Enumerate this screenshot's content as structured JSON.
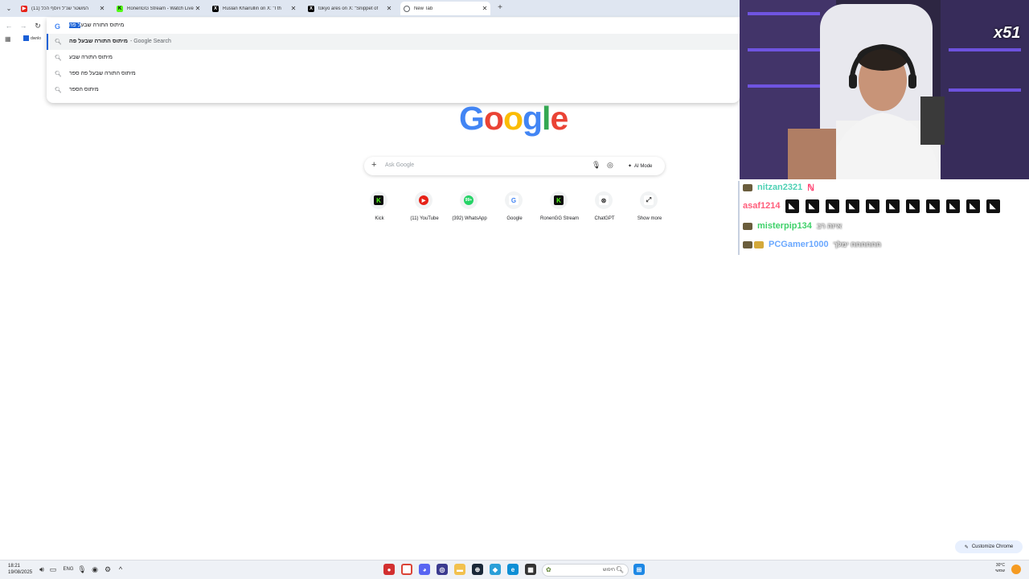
{
  "tabs": [
    {
      "title": "(11) המשטר שנ\"ל ויוסף הכל",
      "color": "#e62117",
      "icon": "youtube-icon",
      "active": false
    },
    {
      "title": "RonenGG Stream - Watch Live",
      "color": "#1b1b1b",
      "icon": "kick-icon",
      "active": false
    },
    {
      "title": "Ruslan Khairullin on X: \"I th",
      "color": "#000000",
      "icon": "x-icon",
      "active": false
    },
    {
      "title": "tokyo ares on X: \"Snippet of",
      "color": "#000000",
      "icon": "x-icon",
      "active": false
    },
    {
      "title": "New Tab",
      "color": "#5f6368",
      "icon": "chrome-icon",
      "active": true
    }
  ],
  "omnibox": {
    "typed_plain": "מיתוס התורה שבע",
    "typed_selected": "ל פה",
    "suggestions": [
      {
        "text": "מיתוס התורה שבעל פה",
        "sub": "- Google Search"
      },
      {
        "text": "מיתוס התורה שבע",
        "sub": ""
      },
      {
        "text": "מיתוס התורה שבעל פה ספר",
        "sub": ""
      },
      {
        "text": "מיתוס הספר",
        "sub": ""
      }
    ]
  },
  "bookmark": {
    "label": "dwnlo"
  },
  "google": {
    "logo_letters": [
      "G",
      "o",
      "o",
      "g",
      "l",
      "e"
    ],
    "logo_colors": [
      "#4285f4",
      "#ea4335",
      "#fbbc05",
      "#4285f4",
      "#34a853",
      "#ea4335"
    ],
    "search_placeholder": "Ask Google",
    "ai_mode_label": "AI Mode"
  },
  "shortcuts": [
    {
      "label": "Kick",
      "glyph": "K",
      "color": "#0c0c0c",
      "icon": "kick-icon"
    },
    {
      "label": "(11) YouTube",
      "glyph": "▶",
      "color": "#e62117",
      "icon": "youtube-icon"
    },
    {
      "label": "(392) WhatsApp",
      "glyph": "99+",
      "color": "#25d366",
      "icon": "whatsapp-icon"
    },
    {
      "label": "Google",
      "glyph": "G",
      "color": "#ffffff",
      "icon": "google-icon"
    },
    {
      "label": "RonenGG Stream",
      "glyph": "K",
      "color": "#0c0c0c",
      "icon": "kick-icon"
    },
    {
      "label": "ChatGPT",
      "glyph": "⊛",
      "color": "#ffffff",
      "icon": "chatgpt-icon"
    },
    {
      "label": "Show more",
      "glyph": "⤢",
      "color": "#ffffff",
      "icon": "expand-icon"
    }
  ],
  "customize_label": "Customize Chrome",
  "stream": {
    "badge": "x51",
    "chat": [
      {
        "user": "nitzan2321",
        "color": "#4fd1b5",
        "msg": "",
        "emotes": 0
      },
      {
        "user": "asaf1214",
        "color": "#ff5d7a",
        "msg": "",
        "emotes": 11
      },
      {
        "user": "misterpip134",
        "color": "#3fd16a",
        "msg": "איזה רב",
        "emotes": 0
      },
      {
        "user": "PCGamer1000",
        "color": "#6aa8ff",
        "msg": "חחחחחח ימלך",
        "emotes": 0
      }
    ]
  },
  "taskbar": {
    "time": "18:21",
    "date": "19/08/2025",
    "lang": "ENG",
    "search_placeholder": "חיפוש",
    "weather_temp": "30°C",
    "weather_desc": "שמשי"
  },
  "accent_color": "#1a62d6"
}
